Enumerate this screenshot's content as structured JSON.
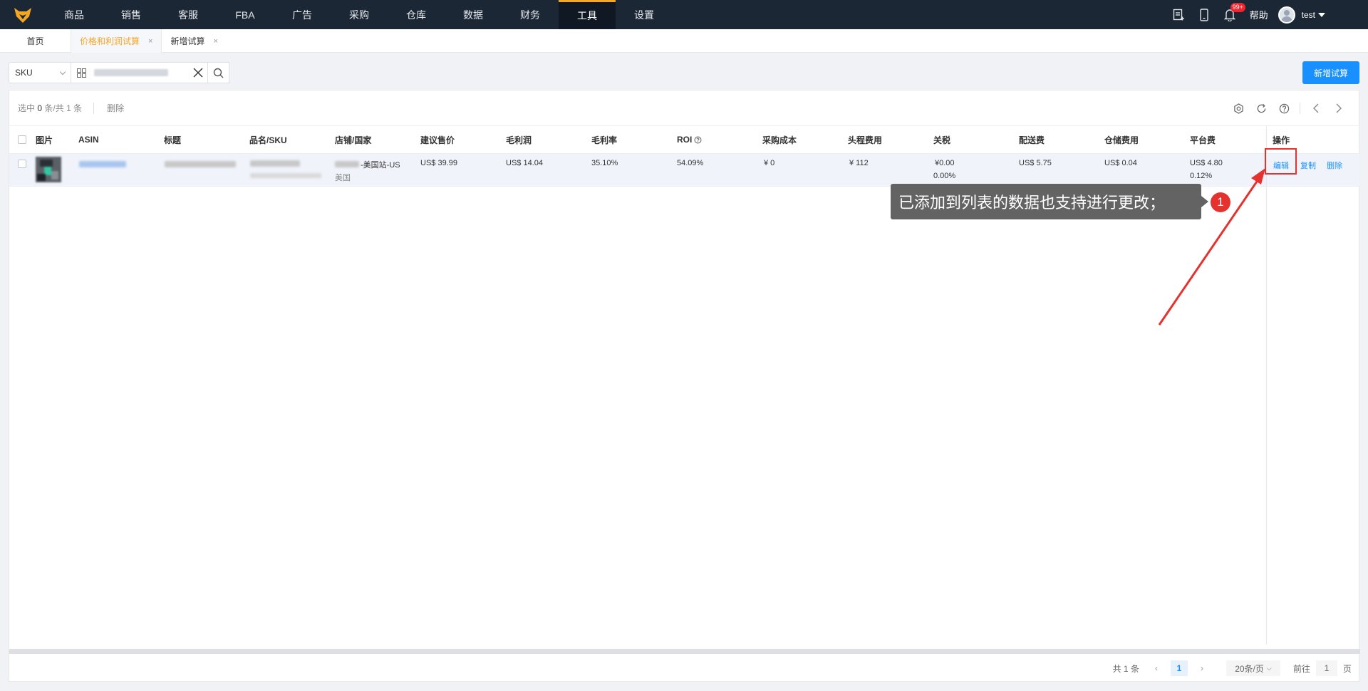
{
  "nav": {
    "items": [
      "商品",
      "销售",
      "客服",
      "FBA",
      "广告",
      "采购",
      "仓库",
      "数据",
      "财务",
      "工具",
      "设置"
    ],
    "active_index": 9,
    "badge": "99+",
    "help": "帮助",
    "user": "test"
  },
  "tabs": {
    "home": "首页",
    "active": "价格和利润试算",
    "other": "新增试算"
  },
  "filter": {
    "select_value": "SKU",
    "new_button": "新增试算"
  },
  "toolbar": {
    "selected_prefix": "选中",
    "selected_count": "0",
    "selected_mid": "条/共",
    "total": "1",
    "selected_suffix": "条",
    "delete": "删除"
  },
  "table": {
    "headers": {
      "image": "图片",
      "asin": "ASIN",
      "title": "标题",
      "name_sku": "品名/SKU",
      "store": "店铺/国家",
      "price": "建议售价",
      "gross_profit": "毛利润",
      "margin": "毛利率",
      "roi": "ROI",
      "purchase": "采购成本",
      "first_leg": "头程费用",
      "tariff": "关税",
      "delivery": "配送费",
      "storage": "仓储费用",
      "platform": "平台费",
      "ops": "操作"
    },
    "row": {
      "store": "-美国站-US",
      "country": "美国",
      "price": "US$ 39.99",
      "gross_profit": "US$ 14.04",
      "margin": "35.10%",
      "roi": "54.09%",
      "purchase": "¥ 0",
      "first_leg": "¥ 112",
      "tariff": "¥0.00",
      "tariff_rate": "0.00%",
      "delivery": "US$ 5.75",
      "storage": "US$ 0.04",
      "platform": "US$ 4.80",
      "platform_rate": "0.12%",
      "ops": {
        "edit": "编辑",
        "copy": "复制",
        "delete": "删除"
      }
    }
  },
  "pagination": {
    "total_prefix": "共",
    "total": "1",
    "total_suffix": "条",
    "current": "1",
    "page_size": "20条/页",
    "goto_label": "前往",
    "goto_value": "1",
    "goto_suffix": "页"
  },
  "annotation": {
    "text": "已添加到列表的数据也支持进行更改；",
    "number": "1"
  },
  "colors": {
    "nav_bg": "#1c2735",
    "accent_orange": "#f5a623",
    "primary_blue": "#1890ff",
    "annotation_red": "#e5322e"
  }
}
